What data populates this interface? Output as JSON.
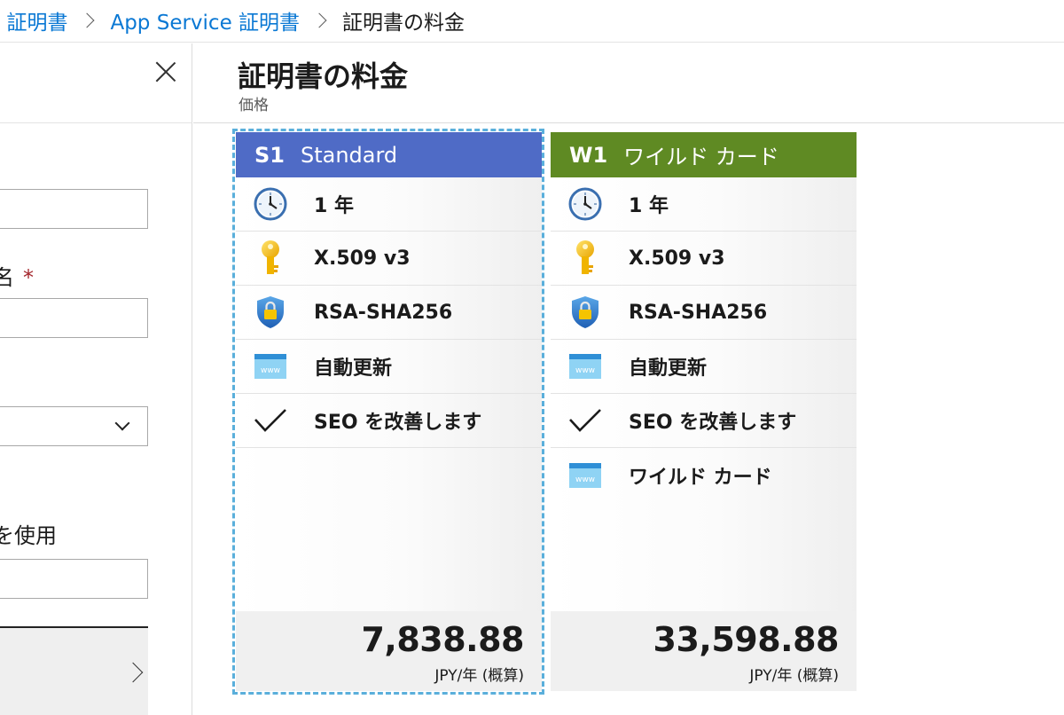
{
  "breadcrumb": {
    "items": [
      "e 証明書",
      "App Service 証明書"
    ],
    "current": "証明書の料金"
  },
  "left_blade": {
    "label_required": "名",
    "label_use": "を使用"
  },
  "header": {
    "title": "証明書の料金",
    "subtitle": "価格"
  },
  "cards": [
    {
      "sku": "S1",
      "name": "Standard",
      "color": "#4f6bc6",
      "selected": true,
      "features": [
        {
          "icon": "clock-icon",
          "text": "1 年"
        },
        {
          "icon": "key-icon",
          "text": "X.509 v3"
        },
        {
          "icon": "shield-lock-icon",
          "text": "RSA-SHA256"
        },
        {
          "icon": "www-icon",
          "text": "自動更新"
        },
        {
          "icon": "checkmark-icon",
          "text": "SEO を改善します"
        }
      ],
      "price": "7,838.88",
      "unit": "JPY/年 (概算)"
    },
    {
      "sku": "W1",
      "name": "ワイルド カード",
      "color": "#5f8a23",
      "selected": false,
      "features": [
        {
          "icon": "clock-icon",
          "text": "1 年"
        },
        {
          "icon": "key-icon",
          "text": "X.509 v3"
        },
        {
          "icon": "shield-lock-icon",
          "text": "RSA-SHA256"
        },
        {
          "icon": "www-icon",
          "text": "自動更新"
        },
        {
          "icon": "checkmark-icon",
          "text": "SEO を改善します"
        },
        {
          "icon": "www-icon",
          "text": "ワイルド カード"
        }
      ],
      "price": "33,598.88",
      "unit": "JPY/年 (概算)"
    }
  ]
}
